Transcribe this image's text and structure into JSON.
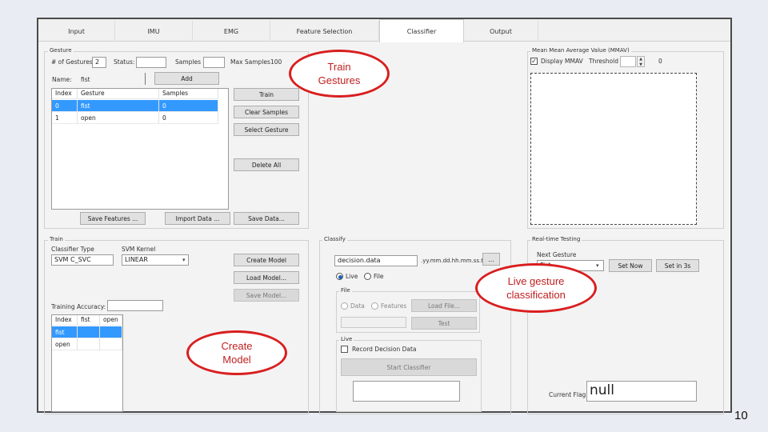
{
  "tabs": [
    {
      "label": "Input"
    },
    {
      "label": "IMU"
    },
    {
      "label": "EMG"
    },
    {
      "label": "Feature Selection"
    },
    {
      "label": "Classifier"
    },
    {
      "label": "Output"
    }
  ],
  "active_tab": "Classifier",
  "gesture": {
    "group_title": "Gesture",
    "num_gestures_label": "# of Gestures",
    "num_gestures_value": "2",
    "status_label": "Status:",
    "status_value": "",
    "samples_label": "Samples",
    "samples_value": "",
    "max_samples_label": "Max Samples",
    "max_samples_value": "100",
    "name_label": "Name:",
    "name_value": "fist",
    "add_button": "Add",
    "table": {
      "columns": [
        "Index",
        "Gesture",
        "Samples"
      ],
      "rows": [
        [
          "0",
          "fist",
          "0"
        ],
        [
          "1",
          "open",
          "0"
        ]
      ]
    },
    "train_button": "Train",
    "clear_samples_button": "Clear Samples",
    "select_gesture_button": "Select Gesture",
    "delete_all_button": "Delete All",
    "save_features_button": "Save Features ...",
    "import_data_button": "Import Data ...",
    "save_data_button": "Save Data..."
  },
  "train": {
    "group_title": "Train",
    "classifier_type_label": "Classifier Type",
    "classifier_type_value": "SVM C_SVC",
    "svm_kernel_label": "SVM Kernel",
    "svm_kernel_value": "LINEAR",
    "create_model_button": "Create Model",
    "load_model_button": "Load Model...",
    "save_model_button": "Save Model...",
    "training_accuracy_label": "Training Accuracy:",
    "training_accuracy_value": "",
    "table": {
      "columns": [
        "Index",
        "fist",
        "open"
      ],
      "rows": [
        [
          "fist",
          "",
          ""
        ],
        [
          "open",
          "",
          ""
        ]
      ]
    }
  },
  "classify": {
    "group_title": "Classify",
    "file_value": "decision.data",
    "file_suffix": ".yy.mm.dd.hh.mm.ss.txt",
    "browse_button": "...",
    "live_radio": "Live",
    "file_radio": "File",
    "file_group_title": "File",
    "data_radio": "Data",
    "features_radio": "Features",
    "load_file_button": "Load File...",
    "test_button": "Test",
    "live_group_title": "Live",
    "record_decision_label": "Record Decision Data",
    "start_classifier_button": "Start Classifier"
  },
  "mmav": {
    "group_title": "Mean Mean Average Value (MMAV)",
    "display_label": "Display MMAV",
    "threshold_label": "Threshold",
    "threshold_value": "0"
  },
  "realtime": {
    "group_title": "Real-time Testing",
    "next_gesture_label": "Next Gesture",
    "next_gesture_value": "Fist",
    "set_now_button": "Set Now",
    "set_in_button": "Set in 3s",
    "current_flag_label": "Current Flag",
    "current_flag_value": "null"
  },
  "annotations": {
    "train_gestures": [
      "Train",
      "Gestures"
    ],
    "live_gesture": [
      "Live gesture",
      "classification"
    ],
    "create_model": [
      "Create",
      "Model"
    ]
  },
  "slide_number": "10",
  "colors": {
    "selection": "#3399ff",
    "annotation_red": "#d91e1e"
  }
}
